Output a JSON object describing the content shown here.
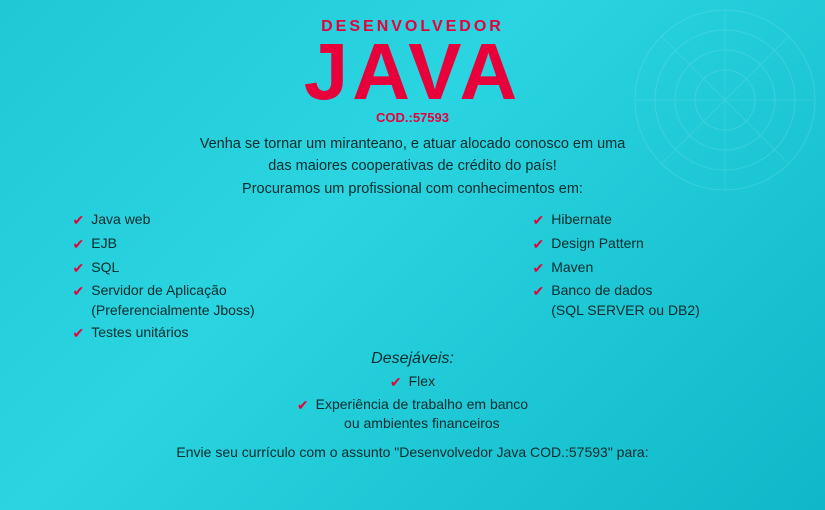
{
  "header": {
    "desenvolvedor": "DESENVOLVEDOR",
    "title": "JAVA",
    "cod": "COD.:57593"
  },
  "intro": {
    "line1": "Venha se tornar um miranteano, e atuar alocado conosco em uma",
    "line2": "das maiores cooperativas de crédito do país!",
    "line3": "Procuramos um profissional com conhecimentos em:"
  },
  "skills_left": [
    {
      "text": "Java web"
    },
    {
      "text": "EJB"
    },
    {
      "text": "SQL"
    },
    {
      "text": "Servidor de Aplicação\n(Preferencialmente Jboss)"
    },
    {
      "text": "Testes unitários"
    }
  ],
  "skills_right": [
    {
      "text": "Hibernate"
    },
    {
      "text": "Design Pattern"
    },
    {
      "text": "Maven"
    },
    {
      "text": "Banco de dados\n(SQL SERVER ou DB2)"
    }
  ],
  "desejavel": {
    "title": "Desejáveis:",
    "items": [
      {
        "text": "Flex"
      },
      {
        "text": "Experiência de trabalho em banco\nou ambientes financeiros"
      }
    ]
  },
  "footer": {
    "text": "Envie seu currículo com o assunto \"Desenvolvedor Java COD.:57593\" para:"
  },
  "icons": {
    "check": "✔"
  }
}
